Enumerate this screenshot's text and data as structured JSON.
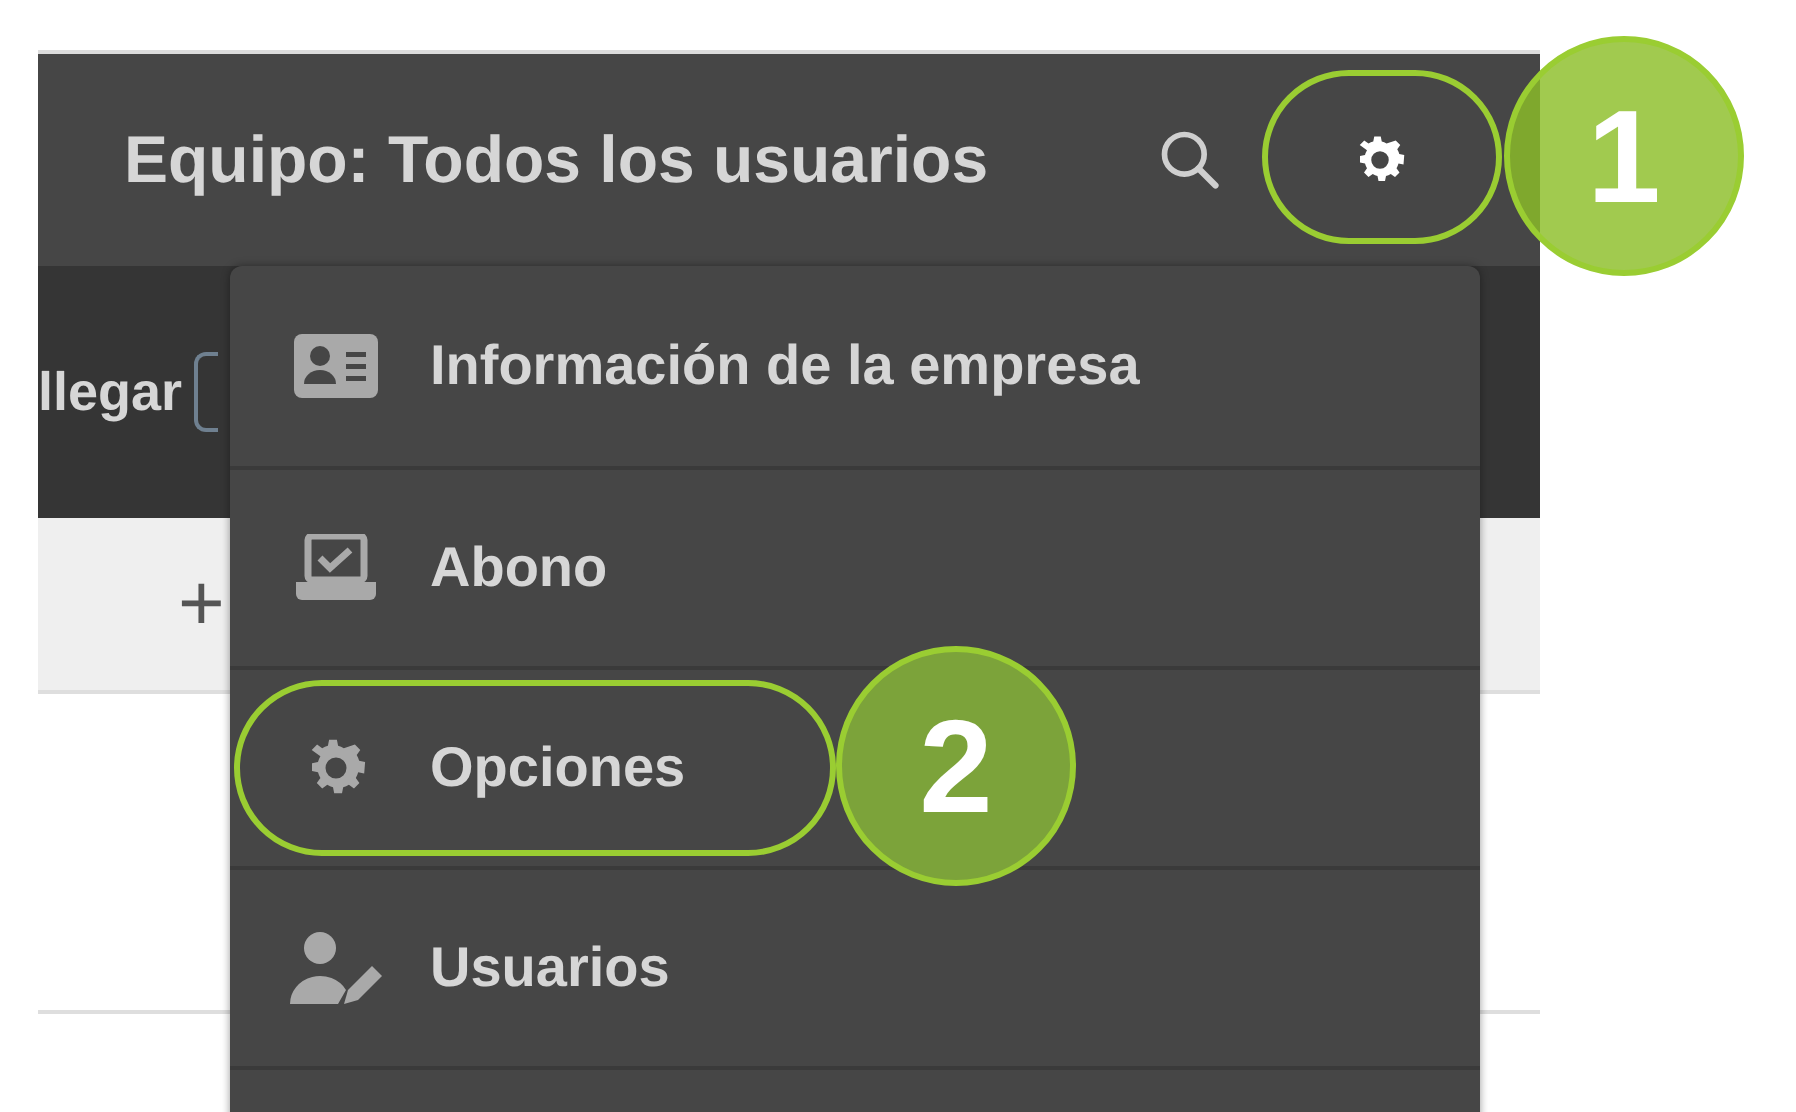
{
  "header": {
    "title": "Equipo: Todos los usuarios"
  },
  "toolbar": {
    "label": "llegar"
  },
  "add_row": {
    "icon_text": "+"
  },
  "menu": [
    {
      "label": "Información de la empresa",
      "kind": "card"
    },
    {
      "label": "Abono",
      "kind": "tray"
    },
    {
      "label": "Opciones",
      "kind": "gear"
    },
    {
      "label": "Usuarios",
      "kind": "user"
    }
  ],
  "callouts": [
    {
      "label": "1",
      "ring": true
    },
    {
      "label": "2",
      "ring": true
    }
  ]
}
